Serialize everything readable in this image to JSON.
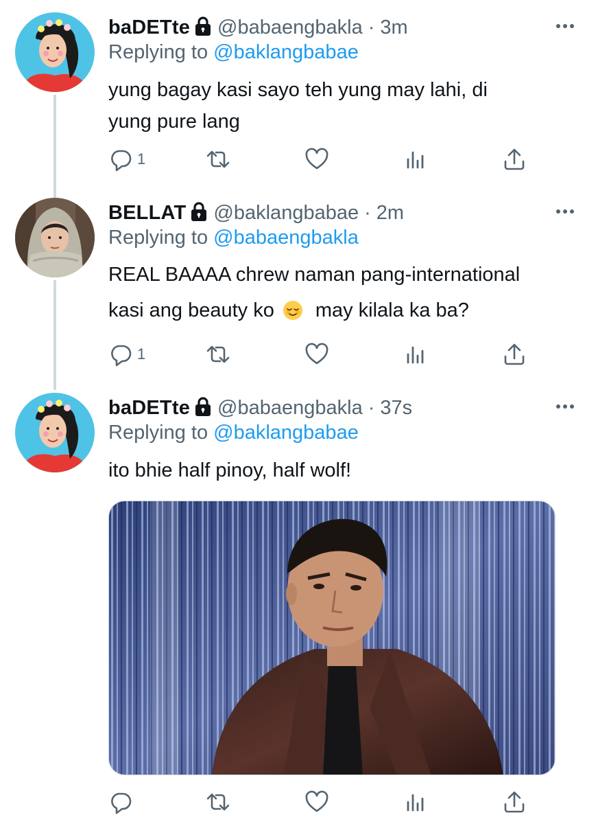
{
  "tweets": [
    {
      "display_name": "baDETte",
      "handle": "@babaengbakla",
      "separator": "·",
      "time": "3m",
      "replying_prefix": "Replying to",
      "replying_to": "@baklangbabae",
      "text_lines": [
        "yung bagay kasi sayo teh yung may lahi, di",
        "yung pure lang"
      ],
      "reply_count": "1",
      "avatar_icon": "avatar-woman-flower-crown"
    },
    {
      "display_name": "BELLAT",
      "handle": "@baklangbabae",
      "separator": "·",
      "time": "2m",
      "replying_prefix": "Replying to",
      "replying_to": "@babaengbakla",
      "text_lines": [
        "REAL BAAAA chrew naman pang-international",
        "kasi ang beauty ko",
        "may kilala ka ba?"
      ],
      "reply_count": "1",
      "avatar_icon": "avatar-woman-hood-scarf"
    },
    {
      "display_name": "baDETte",
      "handle": "@babaengbakla",
      "separator": "·",
      "time": "37s",
      "replying_prefix": "Replying to",
      "replying_to": "@baklangbabae",
      "text_lines": [
        "ito bhie half pinoy, half wolf!"
      ],
      "reply_count": "",
      "avatar_icon": "avatar-woman-flower-crown",
      "media": "photo-man-leather-jacket-tinsel-curtain"
    }
  ],
  "colors": {
    "text": "#0f1419",
    "secondary": "#536471",
    "link": "#1d9bf0",
    "line": "#cfd9de"
  },
  "icons": [
    "lock-icon",
    "more-icon",
    "reply-icon",
    "retweet-icon",
    "like-icon",
    "analytics-icon",
    "share-icon",
    "relieved-face-emoji"
  ]
}
